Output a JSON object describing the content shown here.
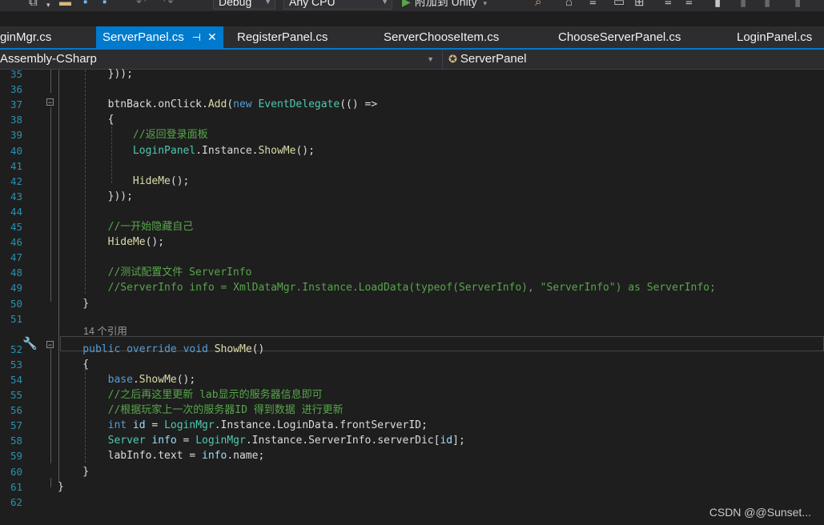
{
  "toolbar": {
    "config_value": "Debug",
    "platform_value": "Any CPU",
    "attach_label": "附加到 Unity"
  },
  "tabs": [
    {
      "label": "ginMgr.cs"
    },
    {
      "label": "ServerPanel.cs"
    },
    {
      "label": "RegisterPanel.cs"
    },
    {
      "label": "ServerChooseItem.cs"
    },
    {
      "label": "ChooseServerPanel.cs"
    },
    {
      "label": "LoginPanel.cs"
    }
  ],
  "navbar": {
    "project": "Assembly-CSharp",
    "class": "ServerPanel"
  },
  "editor": {
    "ref_hint": "14 个引用",
    "lines": [
      {
        "n": "35",
        "tokens": [
          {
            "c": "",
            "t": "        }));"
          }
        ]
      },
      {
        "n": "36",
        "tokens": []
      },
      {
        "n": "37",
        "tokens": [
          {
            "c": "",
            "t": "        btnBack.onClick."
          },
          {
            "c": "fn",
            "t": "Add"
          },
          {
            "c": "",
            "t": "("
          },
          {
            "c": "kw",
            "t": "new"
          },
          {
            "c": "",
            "t": " "
          },
          {
            "c": "ty",
            "t": "EventDelegate"
          },
          {
            "c": "",
            "t": "(() =>"
          }
        ]
      },
      {
        "n": "38",
        "tokens": [
          {
            "c": "",
            "t": "        {"
          }
        ]
      },
      {
        "n": "39",
        "tokens": [
          {
            "c": "cm",
            "t": "            //返回登录面板"
          }
        ]
      },
      {
        "n": "40",
        "tokens": [
          {
            "c": "",
            "t": "            "
          },
          {
            "c": "ty",
            "t": "LoginPanel"
          },
          {
            "c": "",
            "t": ".Instance."
          },
          {
            "c": "fn",
            "t": "ShowMe"
          },
          {
            "c": "",
            "t": "();"
          }
        ]
      },
      {
        "n": "41",
        "tokens": []
      },
      {
        "n": "42",
        "tokens": [
          {
            "c": "",
            "t": "            "
          },
          {
            "c": "fn",
            "t": "HideMe"
          },
          {
            "c": "",
            "t": "();"
          }
        ]
      },
      {
        "n": "43",
        "tokens": [
          {
            "c": "",
            "t": "        }));"
          }
        ]
      },
      {
        "n": "44",
        "tokens": []
      },
      {
        "n": "45",
        "tokens": [
          {
            "c": "cm",
            "t": "        //一开始隐藏自己"
          }
        ]
      },
      {
        "n": "46",
        "tokens": [
          {
            "c": "",
            "t": "        "
          },
          {
            "c": "fn",
            "t": "HideMe"
          },
          {
            "c": "",
            "t": "();"
          }
        ]
      },
      {
        "n": "47",
        "tokens": []
      },
      {
        "n": "48",
        "tokens": [
          {
            "c": "cm",
            "t": "        //测试配置文件 ServerInfo"
          }
        ]
      },
      {
        "n": "49",
        "tokens": [
          {
            "c": "cm",
            "t": "        //ServerInfo info = XmlDataMgr.Instance.LoadData(typeof(ServerInfo), \"ServerInfo\") as ServerInfo;"
          }
        ]
      },
      {
        "n": "50",
        "tokens": [
          {
            "c": "",
            "t": "    }"
          }
        ]
      },
      {
        "n": "51",
        "tokens": []
      },
      {
        "n": "52",
        "tokens": [
          {
            "c": "kw",
            "t": "    public"
          },
          {
            "c": "",
            "t": " "
          },
          {
            "c": "kw",
            "t": "override"
          },
          {
            "c": "",
            "t": " "
          },
          {
            "c": "kw",
            "t": "void"
          },
          {
            "c": "",
            "t": " "
          },
          {
            "c": "fn",
            "t": "ShowMe"
          },
          {
            "c": "",
            "t": "()"
          }
        ]
      },
      {
        "n": "53",
        "tokens": [
          {
            "c": "",
            "t": "    {"
          }
        ]
      },
      {
        "n": "54",
        "tokens": [
          {
            "c": "",
            "t": "        "
          },
          {
            "c": "kw",
            "t": "base"
          },
          {
            "c": "",
            "t": "."
          },
          {
            "c": "fn",
            "t": "ShowMe"
          },
          {
            "c": "",
            "t": "();"
          }
        ]
      },
      {
        "n": "55",
        "tokens": [
          {
            "c": "cm",
            "t": "        //之后再这里更新 lab显示的服务器信息即可"
          }
        ]
      },
      {
        "n": "56",
        "tokens": [
          {
            "c": "cm",
            "t": "        //根据玩家上一次的服务器ID 得到数据 进行更新"
          }
        ]
      },
      {
        "n": "57",
        "tokens": [
          {
            "c": "kw",
            "t": "        int"
          },
          {
            "c": "",
            "t": " "
          },
          {
            "c": "id",
            "t": "id"
          },
          {
            "c": "",
            "t": " = "
          },
          {
            "c": "ty",
            "t": "LoginMgr"
          },
          {
            "c": "",
            "t": ".Instance.LoginData.frontServerID;"
          }
        ]
      },
      {
        "n": "58",
        "tokens": [
          {
            "c": "ty",
            "t": "        Server"
          },
          {
            "c": "",
            "t": " "
          },
          {
            "c": "id",
            "t": "info"
          },
          {
            "c": "",
            "t": " = "
          },
          {
            "c": "ty",
            "t": "LoginMgr"
          },
          {
            "c": "",
            "t": ".Instance.ServerInfo.serverDic["
          },
          {
            "c": "id",
            "t": "id"
          },
          {
            "c": "",
            "t": "];"
          }
        ]
      },
      {
        "n": "59",
        "tokens": [
          {
            "c": "",
            "t": "        labInfo.text = "
          },
          {
            "c": "id",
            "t": "info"
          },
          {
            "c": "",
            "t": ".name;"
          }
        ]
      },
      {
        "n": "60",
        "tokens": [
          {
            "c": "",
            "t": "    }"
          }
        ]
      },
      {
        "n": "61",
        "tokens": [
          {
            "c": "",
            "t": "}"
          }
        ]
      },
      {
        "n": "62",
        "tokens": []
      }
    ]
  },
  "watermark": "CSDN @@Sunset...",
  "colors": {
    "accent": "#007acc",
    "keyword": "#569cd6",
    "type": "#4ec9b0",
    "method": "#dcdcaa",
    "comment": "#57a64a",
    "identifier": "#9cdcfe",
    "line_number": "#2b91af"
  }
}
